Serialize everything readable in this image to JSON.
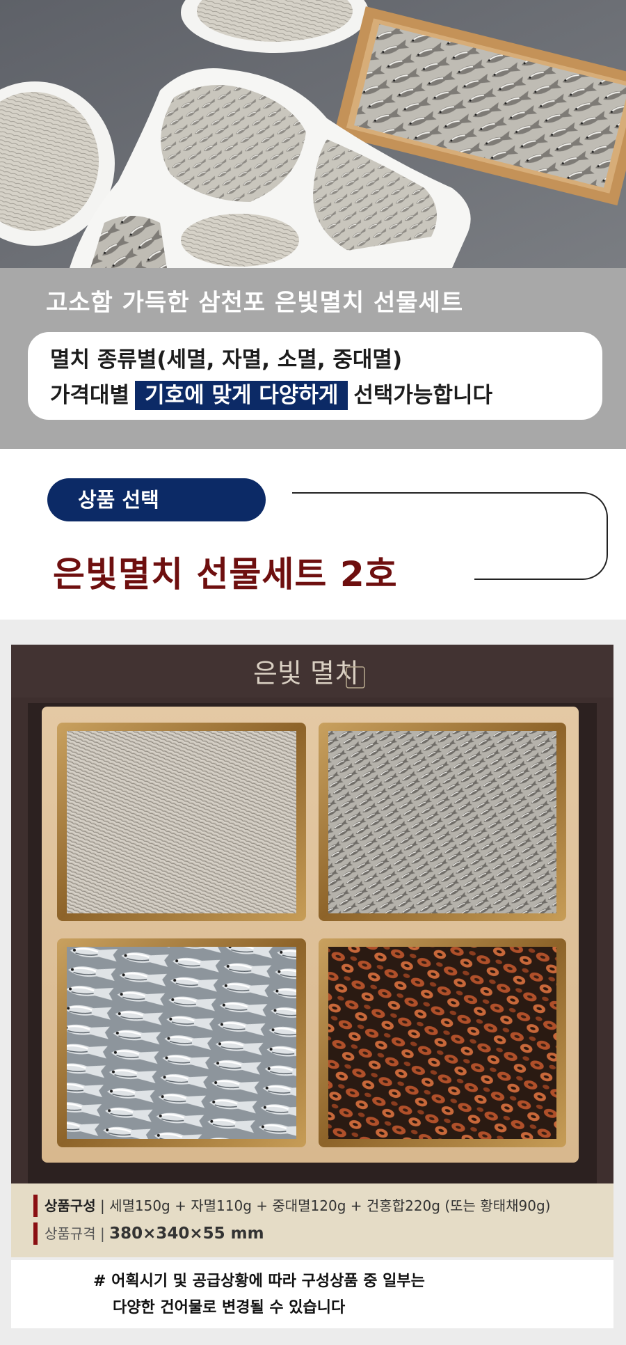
{
  "intro": {
    "title": "고소함 가득한 삼천포 은빛멸치 선물세트",
    "line1": "멸치 종류별(세멸, 자멸, 소멸, 중대멸)",
    "line2_prefix": "가격대별",
    "line2_highlight": "기호에 맞게 다양하게",
    "line2_suffix": "선택가능합니다"
  },
  "select": {
    "pill_label": "상품 선택",
    "product_name": "은빛멸치 선물세트 2호"
  },
  "photo": {
    "box_lid_text": "은빛 멸치"
  },
  "spec": {
    "composition_label": "상품구성",
    "composition_value": "세멸150g + 자멸110g + 중대멸120g + 건홍합220g (또는 황태채90g)",
    "size_label": "상품규격",
    "size_value": "380×340×55 mm",
    "separator": "|"
  },
  "notice": {
    "line1": "# 어획시기 및 공급상황에 따라 구성상품 중 일부는",
    "line2": "다양한 건어물로 변경될 수 있습니다"
  },
  "colors": {
    "navy": "#0c2a66",
    "product_red": "#6e0f0f",
    "band_gray": "#a8a8a8",
    "spec_beige": "#e5dcc6",
    "spec_bar": "#8a0f12"
  }
}
